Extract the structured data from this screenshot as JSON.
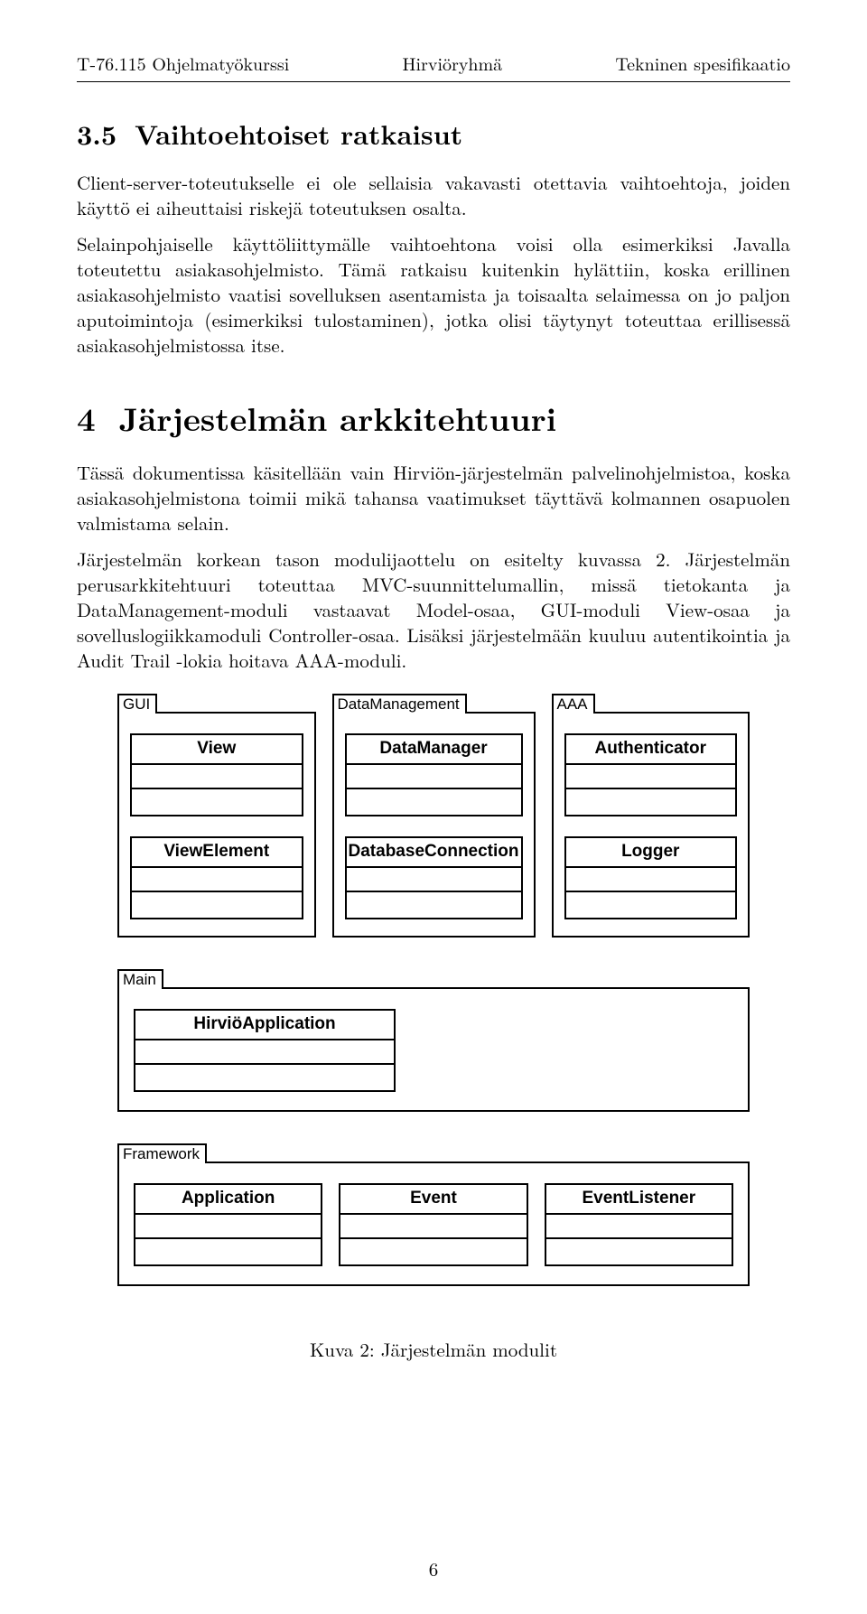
{
  "header": {
    "left": "T-76.115 Ohjelmatyökurssi",
    "center": "Hirviöryhmä",
    "right": "Tekninen spesifikaatio"
  },
  "section35": {
    "number": "3.5",
    "title": "Vaihtoehtoiset ratkaisut",
    "para1": "Client-server-toteutukselle ei ole sellaisia vakavasti otettavia vaihtoehtoja, joiden käyttö ei aiheuttaisi riskejä toteutuksen osalta.",
    "para2": "Selainpohjaiselle käyttöliittymälle vaihtoehtona voisi olla esimerkiksi Javalla toteutettu asiakasohjelmisto. Tämä ratkaisu kuitenkin hylättiin, koska erillinen asiakasohjelmisto vaatisi sovelluksen asentamista ja toisaalta selaimessa on jo paljon aputoimintoja (esimerkiksi tulostaminen), jotka olisi täytynyt toteuttaa erillisessä asiakasohjelmistossa itse."
  },
  "chapter4": {
    "number": "4",
    "title": "Järjestelmän arkkitehtuuri",
    "para1": "Tässä dokumentissa käsitellään vain Hirviön-järjestelmän palvelinohjelmistoa, koska asiakasohjelmistona toimii mikä tahansa vaatimukset täyttävä kolmannen osapuolen valmistama selain.",
    "para2": "Järjestelmän korkean tason modulijaottelu on esitelty kuvassa 2. Järjestelmän perusarkkitehtuuri toteuttaa MVC-suunnittelumallin, missä tietokanta ja DataManagement-moduli vastaavat Model-osaa, GUI-moduli View-osaa ja sovelluslogiikkamoduli Controller-osaa. Lisäksi järjestelmään kuuluu autentikointia ja Audit Trail -lokia hoitava AAA-moduli."
  },
  "diagram": {
    "packages": {
      "gui": {
        "label": "GUI",
        "classes": [
          "View",
          "ViewElement"
        ]
      },
      "dm": {
        "label": "DataManagement",
        "classes": [
          "DataManager",
          "DatabaseConnection"
        ]
      },
      "aaa": {
        "label": "AAA",
        "classes": [
          "Authenticator",
          "Logger"
        ]
      },
      "main": {
        "label": "Main",
        "classes": [
          "HirviöApplication"
        ]
      },
      "framework": {
        "label": "Framework",
        "classes": [
          "Application",
          "Event",
          "EventListener"
        ]
      }
    }
  },
  "caption": "Kuva 2: Järjestelmän modulit",
  "pageNumber": "6"
}
